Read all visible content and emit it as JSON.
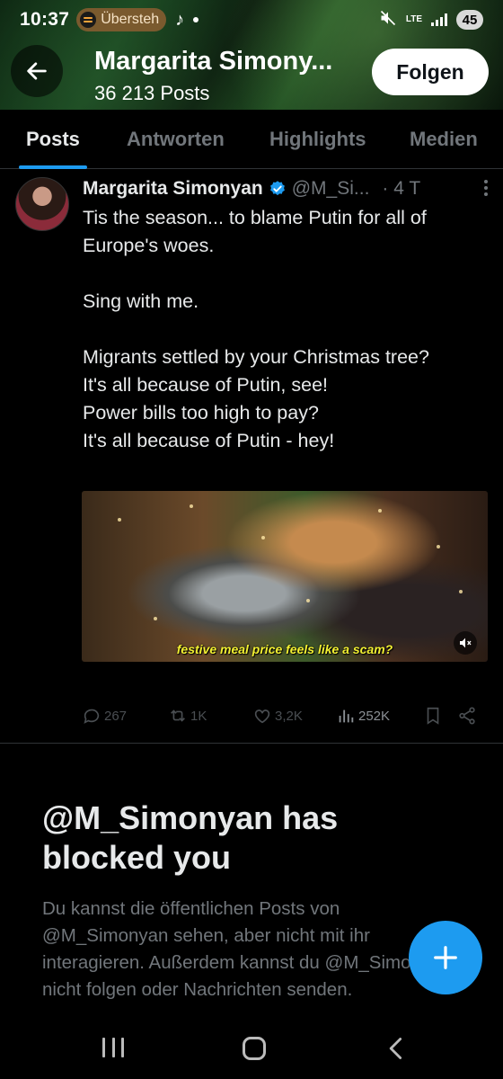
{
  "status_bar": {
    "time": "10:37",
    "media_app_text": "Übersteh",
    "battery": "45",
    "network": "LTE",
    "icons": [
      "spotify-icon",
      "tiktok-icon",
      "mute-icon",
      "signal-icon",
      "battery-icon"
    ]
  },
  "header": {
    "name": "Margarita Simony...",
    "post_count": "36 213 Posts",
    "follow_label": "Folgen"
  },
  "tabs": [
    {
      "label": "Posts",
      "active": true
    },
    {
      "label": "Antworten",
      "active": false
    },
    {
      "label": "Highlights",
      "active": false
    },
    {
      "label": "Medien",
      "active": false
    }
  ],
  "tweet": {
    "author_name": "Margarita Simonyan",
    "handle": "@M_Si...",
    "time_ago": "· 4 T",
    "lines": [
      "Tis the season... to blame Putin for all of Europe's woes.",
      "",
      "Sing with me.",
      "",
      "Migrants settled by your Christmas tree?",
      "It's all because of Putin, see!",
      "Power bills too high to pay?",
      "It's all because of Putin - hey!"
    ],
    "media_subtitle": "festive meal price feels like a scam?",
    "stats": {
      "replies": "267",
      "reposts": "1K",
      "likes": "3,2K",
      "views": "252K"
    }
  },
  "blocked": {
    "title": "@M_Simonyan has blocked you",
    "description": "Du kannst die öffentlichen Posts von @M_Simonyan sehen, aber nicht mit ihr interagieren. Außerdem kannst du @M_Simonyan nicht folgen oder Nachrichten senden."
  },
  "colors": {
    "accent": "#1d9bf0",
    "background": "#000000",
    "text_primary": "#e7e9ea",
    "text_secondary": "#71767b"
  }
}
